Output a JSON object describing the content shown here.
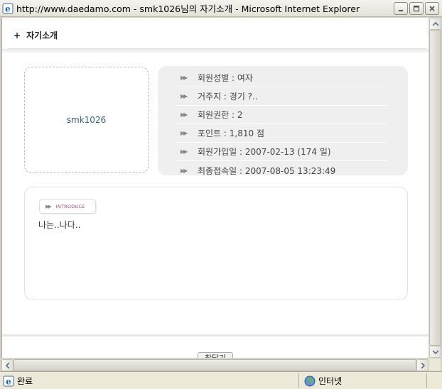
{
  "window": {
    "title": "http://www.daedamo.com - smk1026님의 자기소개 - Microsoft Internet Explorer"
  },
  "page": {
    "header_plus": "+",
    "header_title": "자기소개",
    "user_id": "smk1026",
    "info": [
      {
        "text": "회원성별 : 여자"
      },
      {
        "text": "거주지 : 경기 ?.."
      },
      {
        "text": "회원권한 : 2"
      },
      {
        "text": "포인트 : 1,810 점"
      },
      {
        "text": "회원가입일 : 2007-02-13 (174 일)"
      },
      {
        "text": "최종접속일 : 2007-08-05 13:23:49"
      }
    ],
    "intro_label": "INTRODUCE",
    "intro_text": "나는..나다..",
    "close_button": "창닫기"
  },
  "statusbar": {
    "left_text": "완료",
    "right_text": "인터넷"
  },
  "icons": {
    "bullet": "double-triangle-right",
    "ie": "ie-icon",
    "globe": "internet-zone-icon"
  },
  "colors": {
    "user_id": "#2e5f8f",
    "intro_label": "#a2476e",
    "info_bg": "#efefef"
  }
}
